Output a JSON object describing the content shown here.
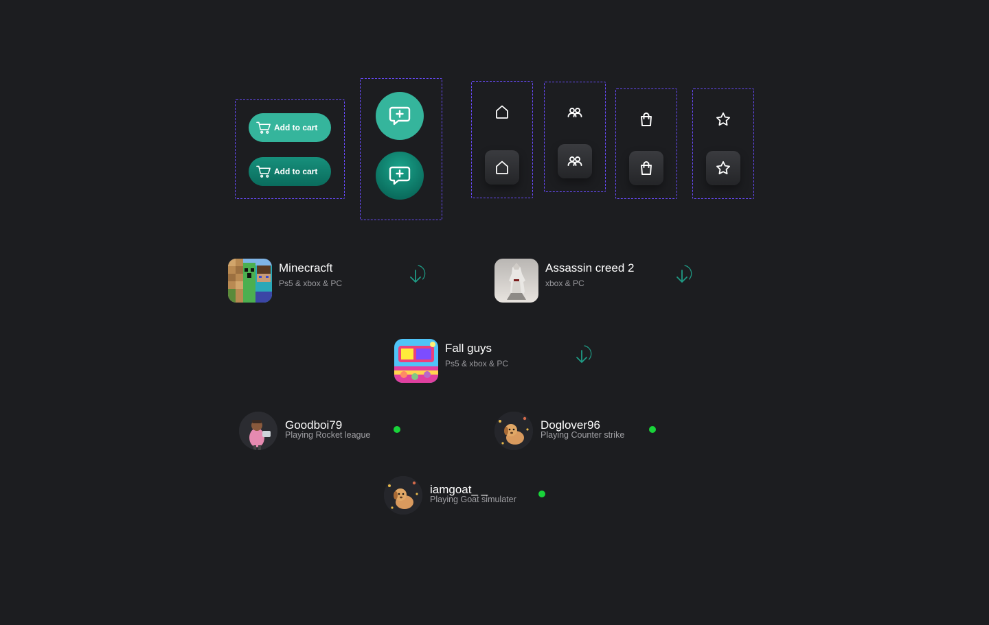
{
  "colors": {
    "background": "#1c1d20",
    "frame_dash": "#6a4cff",
    "accent_teal": "#35b59c",
    "accent_teal_dark": "#0a6c5d",
    "online": "#19d33a"
  },
  "buttons": {
    "add_to_cart_primary": {
      "label": "Add to cart",
      "icon": "cart-icon"
    },
    "add_to_cart_pressed": {
      "label": "Add to cart",
      "icon": "cart-icon"
    },
    "chat_primary": {
      "icon": "chat-add-icon"
    },
    "chat_pressed": {
      "icon": "chat-add-icon"
    }
  },
  "nav_icons": [
    {
      "name": "home",
      "icon": "home-icon"
    },
    {
      "name": "friends",
      "icon": "users-icon"
    },
    {
      "name": "shop",
      "icon": "shopping-bag-icon"
    },
    {
      "name": "favorites",
      "icon": "star-icon"
    }
  ],
  "games": [
    {
      "title": "Minecracft",
      "platforms": "Ps5 & xbox & PC",
      "action_icon": "download-icon"
    },
    {
      "title": "Assassin creed 2",
      "platforms": "xbox & PC",
      "action_icon": "download-icon"
    },
    {
      "title": "Fall guys",
      "platforms": "Ps5 & xbox & PC",
      "action_icon": "download-icon"
    }
  ],
  "friends": [
    {
      "username": "Goodboi79",
      "status": "Playing Rocket league",
      "online": true
    },
    {
      "username": "Doglover96",
      "status": "Playing Counter strike",
      "online": true
    },
    {
      "username": "iamgoat_ _",
      "status": "Playing Goat simulater",
      "online": true
    }
  ]
}
